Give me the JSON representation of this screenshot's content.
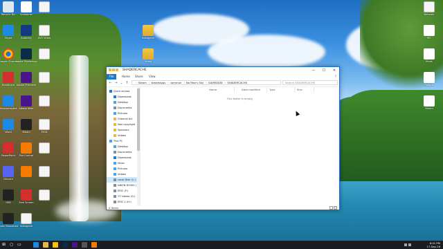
{
  "desktop": {
    "left_icons": [
      {
        "label": "Recycle Bin",
        "glyph": "recycle-bin-icon",
        "color": "#dfe7ef"
      },
      {
        "label": "Videoproc",
        "glyph": "app-icon",
        "color": "#ffffff"
      },
      {
        "label": "",
        "glyph": "document-icon",
        "color": "#ffffff"
      },
      {
        "label": "Skype",
        "glyph": "skype-icon",
        "color": "#1e88e5"
      },
      {
        "label": "Audacity",
        "glyph": "audacity-icon",
        "color": "#123a82"
      },
      {
        "label": "AVS Video",
        "glyph": "document-icon",
        "color": "#ffffff"
      },
      {
        "label": "Google Chrome",
        "glyph": "chrome-icon",
        "color": "#fbbc05"
      },
      {
        "label": "Adobe Photoshop",
        "glyph": "photoshop-icon",
        "color": "#0b2b4a"
      },
      {
        "label": "",
        "glyph": "document-icon",
        "color": "#ffffff"
      },
      {
        "label": "Bandicam",
        "glyph": "bandicam-icon",
        "color": "#d32f2f"
      },
      {
        "label": "Adobe Premiere",
        "glyph": "premiere-icon",
        "color": "#4a148c"
      },
      {
        "label": "",
        "glyph": "document-icon",
        "color": "#ffffff"
      },
      {
        "label": "Malwarebytes",
        "glyph": "malwarebytes-icon",
        "color": "#1e88e5"
      },
      {
        "label": "Adobe After",
        "glyph": "after-effects-icon",
        "color": "#4a148c"
      },
      {
        "label": "",
        "glyph": "document-icon",
        "color": "#ffffff"
      },
      {
        "label": "Word",
        "glyph": "word-icon",
        "color": "#1e88e5"
      },
      {
        "label": "Steam",
        "glyph": "steam-icon",
        "color": "#222222"
      },
      {
        "label": "MOD",
        "glyph": "document-icon",
        "color": "#ffffff"
      },
      {
        "label": "PowerPoint",
        "glyph": "powerpoint-icon",
        "color": "#d32f2f"
      },
      {
        "label": "Fan Control",
        "glyph": "app-icon",
        "color": "#f57c00"
      },
      {
        "label": "",
        "glyph": "document-icon",
        "color": "#ffffff"
      },
      {
        "label": "Discord",
        "glyph": "discord-icon",
        "color": "#5865f2"
      },
      {
        "label": "",
        "glyph": "app-icon",
        "color": "#f57c00"
      },
      {
        "label": "",
        "glyph": "document-icon",
        "color": "#ffffff"
      },
      {
        "label": "OBS",
        "glyph": "obs-icon",
        "color": "#222222"
      },
      {
        "label": "Free Screen",
        "glyph": "app-icon",
        "color": "#d32f2f"
      },
      {
        "label": "",
        "glyph": "document-icon",
        "color": "#ffffff"
      },
      {
        "label": "Open Broadcast",
        "glyph": "obs-icon",
        "color": "#222222"
      },
      {
        "label": "Instagram",
        "glyph": "document-icon",
        "color": "#ffffff"
      }
    ],
    "middle_icons": [
      {
        "label": "Instagram",
        "glyph": "folder-icon"
      },
      {
        "label": "Video",
        "glyph": "folder-icon"
      }
    ],
    "right_icons": [
      {
        "label": "Network",
        "glyph": "document-icon"
      },
      {
        "label": "IRC",
        "glyph": "app-icon"
      },
      {
        "label": "Mods",
        "glyph": "app-icon"
      },
      {
        "label": "Fallout",
        "glyph": "app-icon"
      },
      {
        "label": "Steam",
        "glyph": "app-icon"
      }
    ]
  },
  "window": {
    "title": "SHADERCACHE",
    "min_glyph": "—",
    "max_glyph": "☐",
    "close_glyph": "✕",
    "ribbon_tabs": [
      "File",
      "Home",
      "Share",
      "View"
    ],
    "help_glyph": "?",
    "nav": {
      "back": "←",
      "forward": "→",
      "recent": "⌄",
      "up": "↑"
    },
    "breadcrumbs": [
      "Steam",
      "steamapps",
      "common",
      "No Man's Sky",
      "GAMEDATA",
      "SHADERCACHE"
    ],
    "search_placeholder": "Search SHADERCACHE",
    "nav_items": [
      {
        "label": "Quick access",
        "icon": "star-icon",
        "color": "#1f7ad8",
        "pinned": false,
        "selected": false
      },
      {
        "label": "Downloads",
        "icon": "downloads-icon",
        "color": "#1f7ad8",
        "pinned": true,
        "selected": false
      },
      {
        "label": "Desktop",
        "icon": "desktop-icon",
        "color": "#4aa3e6",
        "pinned": true,
        "selected": false
      },
      {
        "label": "Documents",
        "icon": "documents-icon",
        "color": "#7f8da3",
        "pinned": true,
        "selected": false
      },
      {
        "label": "Pictures",
        "icon": "pictures-icon",
        "color": "#4aa3e6",
        "pinned": true,
        "selected": false
      },
      {
        "label": "Channel Art",
        "icon": "folder-icon",
        "color": "#e6b64a",
        "pinned": false,
        "selected": false
      },
      {
        "label": "Non copyright",
        "icon": "folder-icon",
        "color": "#e6b64a",
        "pinned": false,
        "selected": false
      },
      {
        "label": "Sponsors",
        "icon": "folder-icon",
        "color": "#e6b64a",
        "pinned": false,
        "selected": false
      },
      {
        "label": "Videos",
        "icon": "folder-icon",
        "color": "#e6b64a",
        "pinned": false,
        "selected": false
      },
      {
        "label": "This PC",
        "icon": "computer-icon",
        "color": "#4aa3e6",
        "pinned": false,
        "selected": false
      },
      {
        "label": "Desktop",
        "icon": "desktop-icon",
        "color": "#4aa3e6",
        "pinned": false,
        "selected": false
      },
      {
        "label": "Documents",
        "icon": "documents-icon",
        "color": "#7f8da3",
        "pinned": false,
        "selected": false
      },
      {
        "label": "Downloads",
        "icon": "downloads-icon",
        "color": "#1f7ad8",
        "pinned": false,
        "selected": false
      },
      {
        "label": "Music",
        "icon": "music-icon",
        "color": "#4aa3e6",
        "pinned": false,
        "selected": false
      },
      {
        "label": "Pictures",
        "icon": "pictures-icon",
        "color": "#4aa3e6",
        "pinned": false,
        "selected": false
      },
      {
        "label": "Videos",
        "icon": "videos-icon",
        "color": "#4aa3e6",
        "pinned": false,
        "selected": false
      },
      {
        "label": "Local Disk (C:)",
        "icon": "drive-icon",
        "color": "#7f8da3",
        "pinned": false,
        "selected": true
      },
      {
        "label": "NIKON D5300 (",
        "icon": "drive-icon",
        "color": "#7f8da3",
        "pinned": false,
        "selected": false
      },
      {
        "label": "ERIC (F:)",
        "icon": "drive-icon",
        "color": "#7f8da3",
        "pinned": false,
        "selected": false
      },
      {
        "label": "YT Videos (G:)",
        "icon": "drive-icon",
        "color": "#7f8da3",
        "pinned": false,
        "selected": false
      },
      {
        "label": "ERIC 1 (H:)",
        "icon": "drive-icon",
        "color": "#7f8da3",
        "pinned": false,
        "selected": false
      }
    ],
    "columns": [
      "Name",
      "Date modified",
      "Type",
      "Size"
    ],
    "empty_text": "This folder is empty.",
    "status": "0 items"
  },
  "taskbar": {
    "start_glyph": "⊞",
    "search_glyph": "○",
    "taskview_glyph": "▭",
    "apps": [
      {
        "name": "edge-icon",
        "color": "#1e88e5"
      },
      {
        "name": "file-explorer-icon",
        "color": "#e6b64a"
      },
      {
        "name": "chrome-icon",
        "color": "#fbbc05"
      },
      {
        "name": "photoshop-icon",
        "color": "#0b2b4a"
      },
      {
        "name": "premiere-icon",
        "color": "#4a148c"
      },
      {
        "name": "steam-icon",
        "color": "#555555"
      },
      {
        "name": "app-icon",
        "color": "#f57c00"
      }
    ],
    "time": "8:41 PM",
    "date": "17-Sep-16"
  },
  "colors": {
    "accent": "#1979ca",
    "selection": "#cce8ff",
    "window_border": "#1e6fb8"
  }
}
